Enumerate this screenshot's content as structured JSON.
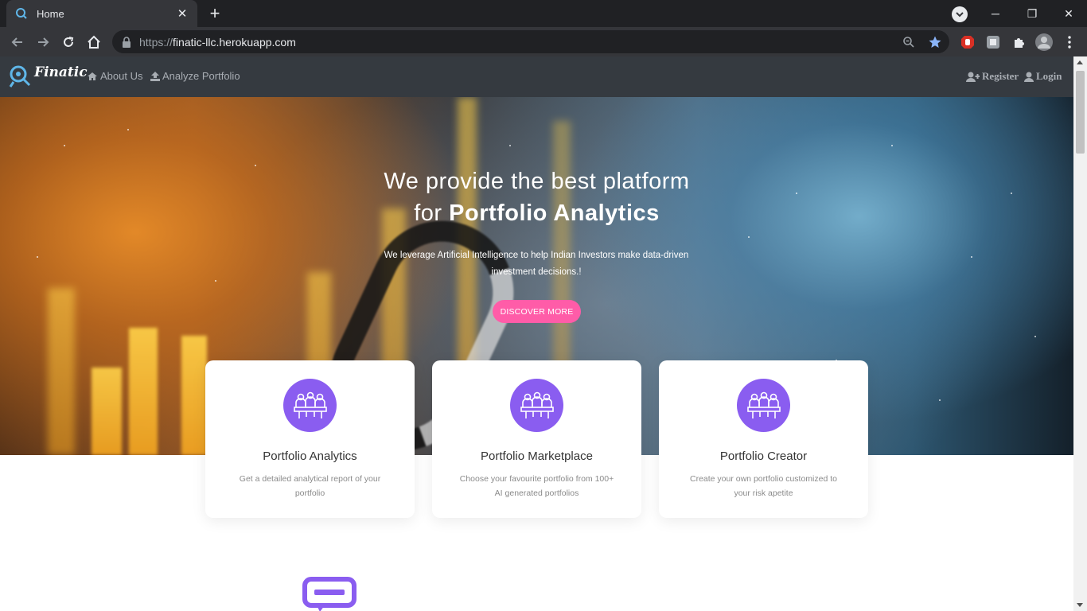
{
  "browser": {
    "tab_title": "Home",
    "url_prefix": "https://",
    "url_host": "finatic-llc.herokuapp.com",
    "accent_color": "#8ab4f8"
  },
  "site_nav": {
    "brand": "Finatic",
    "links": [
      {
        "label": "About Us",
        "icon": "home-icon"
      },
      {
        "label": "Analyze Portfolio",
        "icon": "upload-icon"
      }
    ],
    "register_label": "Register",
    "login_label": "Login"
  },
  "hero": {
    "title_line1": "We provide the best platform",
    "title_line2_prefix": "for ",
    "title_line2_bold": "Portfolio Analytics",
    "subtitle": "We leverage Artificial Intelligence to help Indian Investors make data-driven investment decisions.!",
    "cta_label": "DISCOVER MORE",
    "cta_color": "#ff5ca8"
  },
  "features": [
    {
      "title": "Portfolio Analytics",
      "description": "Get a detailed analytical report of your portfolio",
      "icon": "meeting-icon"
    },
    {
      "title": "Portfolio Marketplace",
      "description": "Choose your favourite portfolio from 100+ AI generated portfolios",
      "icon": "meeting-icon"
    },
    {
      "title": "Portfolio Creator",
      "description": "Create your own portfolio customized to your risk apetite",
      "icon": "meeting-icon"
    }
  ],
  "icon_color": "#8a5df0"
}
